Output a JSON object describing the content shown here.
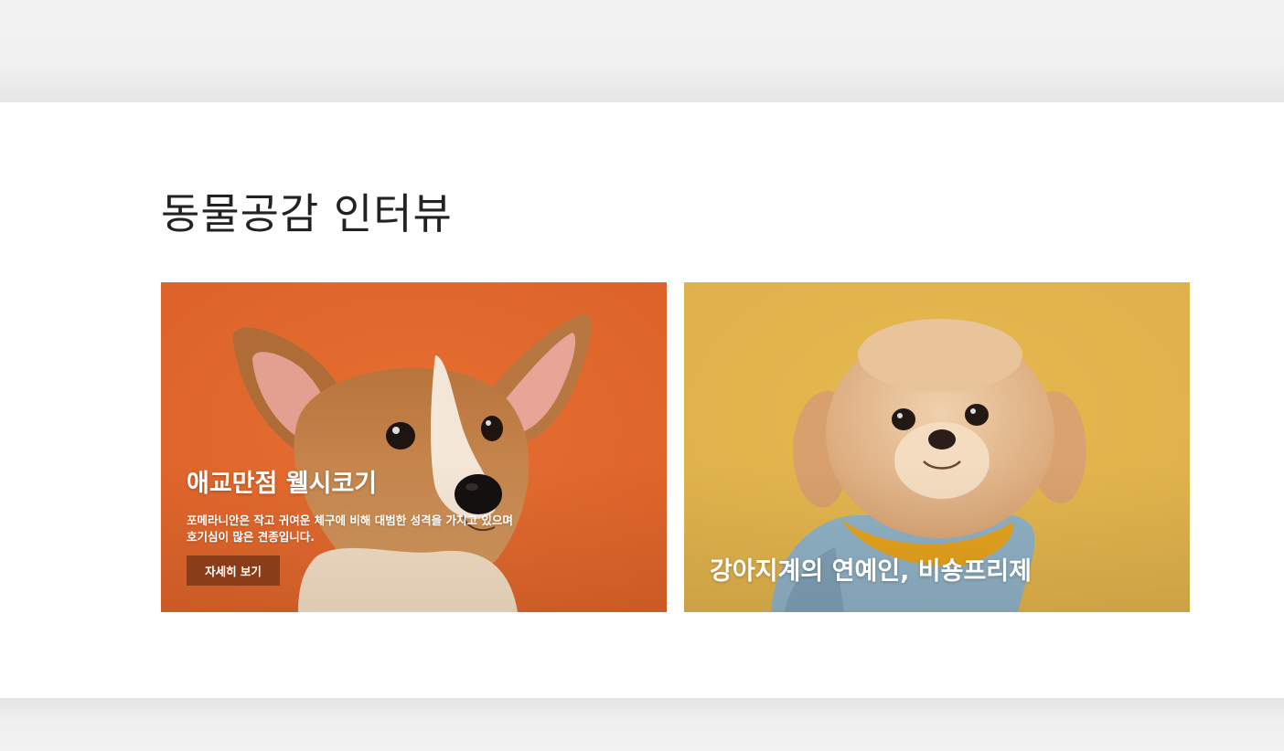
{
  "section": {
    "title": "동물공감 인터뷰"
  },
  "cards": [
    {
      "title": "애교만점 웰시코기",
      "description": "포메라니안은 작고 귀여운 체구에 비해 대범한 성격을 가지고 있으며 호기심이 많은 견종입니다.",
      "button_label": "자세히 보기",
      "background_color": "#e0692e",
      "image": "welsh-corgi-puppy-photo"
    },
    {
      "title": "강아지계의 연예인, 비숑프리제",
      "background_color": "#e3b54e",
      "image": "small-fluffy-dog-photo"
    }
  ],
  "colors": {
    "page_background": "#f2f2f2",
    "section_background": "#ffffff",
    "title_text": "#222222",
    "button_background": "#8a3d19"
  }
}
